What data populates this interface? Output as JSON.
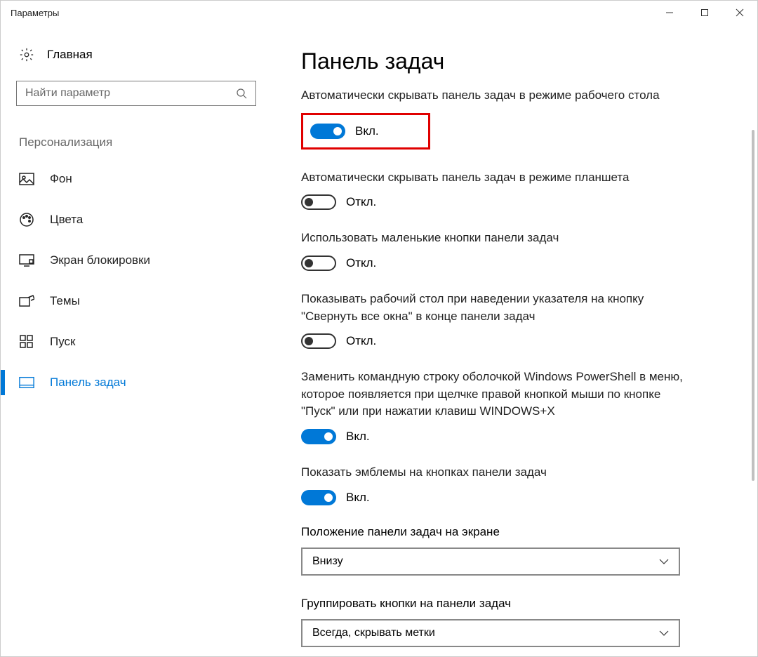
{
  "window": {
    "title": "Параметры"
  },
  "sidebar": {
    "home": "Главная",
    "search_placeholder": "Найти параметр",
    "section": "Персонализация",
    "items": [
      {
        "label": "Фон"
      },
      {
        "label": "Цвета"
      },
      {
        "label": "Экран блокировки"
      },
      {
        "label": "Темы"
      },
      {
        "label": "Пуск"
      },
      {
        "label": "Панель задач"
      }
    ]
  },
  "main": {
    "title": "Панель задач",
    "on_label": "Вкл.",
    "off_label": "Откл.",
    "settings": [
      {
        "label": "Автоматически скрывать панель задач в режиме рабочего стола",
        "state": "on"
      },
      {
        "label": "Автоматически скрывать панель задач в режиме планшета",
        "state": "off"
      },
      {
        "label": "Использовать маленькие кнопки панели задач",
        "state": "off"
      },
      {
        "label": "Показывать рабочий стол при наведении указателя на кнопку \"Свернуть все окна\" в конце панели задач",
        "state": "off"
      },
      {
        "label": "Заменить командную строку оболочкой Windows PowerShell в меню, которое появляется при щелчке правой кнопкой мыши по кнопке \"Пуск\" или при нажатии клавиш WINDOWS+X",
        "state": "on"
      },
      {
        "label": "Показать эмблемы на кнопках панели задач",
        "state": "on"
      }
    ],
    "dropdowns": [
      {
        "label": "Положение панели задач на экране",
        "value": "Внизу"
      },
      {
        "label": "Группировать кнопки на панели задач",
        "value": "Всегда, скрывать метки"
      }
    ]
  }
}
